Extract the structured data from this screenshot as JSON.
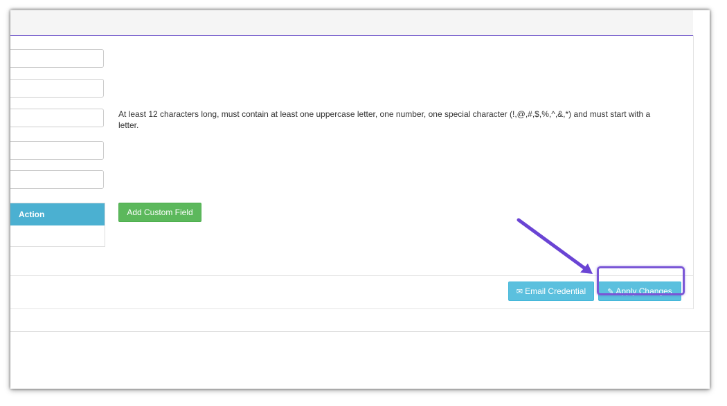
{
  "form": {
    "password_help": "At least 12 characters long, must contain at least one uppercase letter, one number, one special character (!,@,#,$,%,^,&,*) and must start with a letter."
  },
  "custom_fields": {
    "action_header": "Action",
    "add_button": "Add Custom Field"
  },
  "footer": {
    "email_button": "Email Credential",
    "apply_button": "Apply Changes"
  },
  "icons": {
    "email": "envelope-icon",
    "apply": "edit-icon"
  },
  "colors": {
    "heading_underline": "#6c52c9",
    "info": "#5bc0de",
    "success": "#5cb85c",
    "annotation": "#6a44d4"
  }
}
